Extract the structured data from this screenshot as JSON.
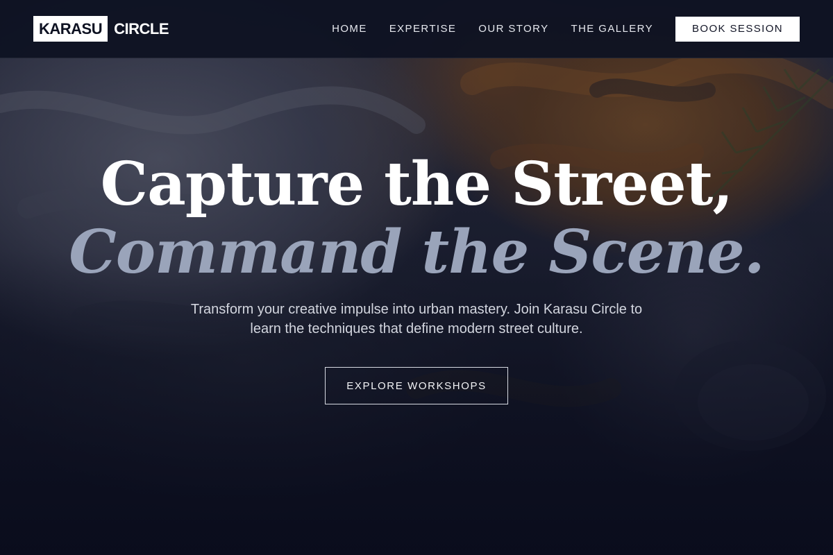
{
  "brand": {
    "box_text": "KARASU",
    "text": "CIRCLE"
  },
  "nav": {
    "items": [
      {
        "label": "HOME"
      },
      {
        "label": "EXPERTISE"
      },
      {
        "label": "OUR STORY"
      },
      {
        "label": "THE GALLERY"
      }
    ],
    "cta_label": "BOOK SESSION"
  },
  "hero": {
    "title_line1": "Capture the Street,",
    "title_line2": "Command the Scene.",
    "subtitle": "Transform your creative impulse into urban mastery. Join Karasu Circle to learn the techniques that define modern street culture.",
    "cta_label": "EXPLORE WORKSHOPS"
  },
  "colors": {
    "background": "#0e1222",
    "accent_title": "#9aa4ba",
    "button_bg": "#ffffff"
  },
  "background_image": {
    "description_icon": "painted-texture-background"
  }
}
